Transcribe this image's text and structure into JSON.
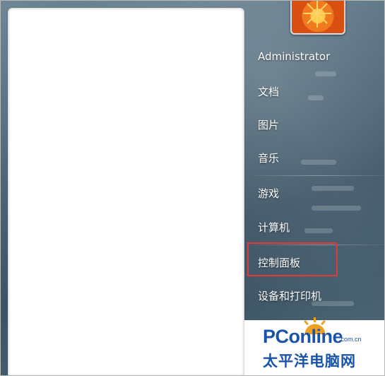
{
  "user": {
    "name": "Administrator"
  },
  "menu": {
    "items": [
      {
        "key": "documents",
        "label": "文档"
      },
      {
        "key": "pictures",
        "label": "图片"
      },
      {
        "key": "music",
        "label": "音乐"
      },
      {
        "key": "games",
        "label": "游戏"
      },
      {
        "key": "computer",
        "label": "计算机"
      },
      {
        "key": "control_panel",
        "label": "控制面板",
        "highlighted": true
      },
      {
        "key": "devices_printers",
        "label": "设备和打印机"
      }
    ]
  },
  "highlight": {
    "color": "#e03a3a",
    "target": "控制面板"
  },
  "watermark": {
    "brand": "PConline",
    "domain": ".com.cn",
    "tagline": "太平洋电脑网"
  }
}
